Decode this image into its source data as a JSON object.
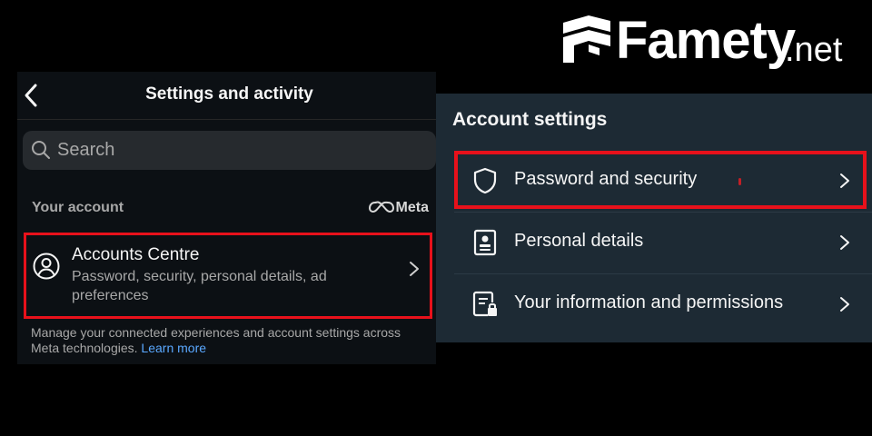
{
  "watermark": {
    "brand": "Famety",
    "tld": ".net"
  },
  "left_panel": {
    "title": "Settings and activity",
    "back_icon": "chevron-left-icon",
    "search": {
      "placeholder": "Search",
      "icon": "search-icon"
    },
    "section": {
      "label": "Your account",
      "brand": "Meta"
    },
    "accounts_centre": {
      "title": "Accounts Centre",
      "subtitle": "Password, security, personal details, ad preferences",
      "icon": "user-circle-icon"
    },
    "footer": {
      "text": "Manage your connected experiences and account settings across Meta technologies.",
      "link": "Learn more"
    }
  },
  "right_panel": {
    "title": "Account settings",
    "rows": [
      {
        "label": "Password and security",
        "icon": "shield-icon",
        "highlighted": true
      },
      {
        "label": "Personal details",
        "icon": "id-card-icon",
        "highlighted": false
      },
      {
        "label": "Your information and permissions",
        "icon": "document-lock-icon",
        "highlighted": false
      }
    ]
  },
  "colors": {
    "highlight": "#e8111b",
    "left_bg": "#0c1014",
    "right_bg": "#1d2a34",
    "link": "#5aa8ff"
  }
}
